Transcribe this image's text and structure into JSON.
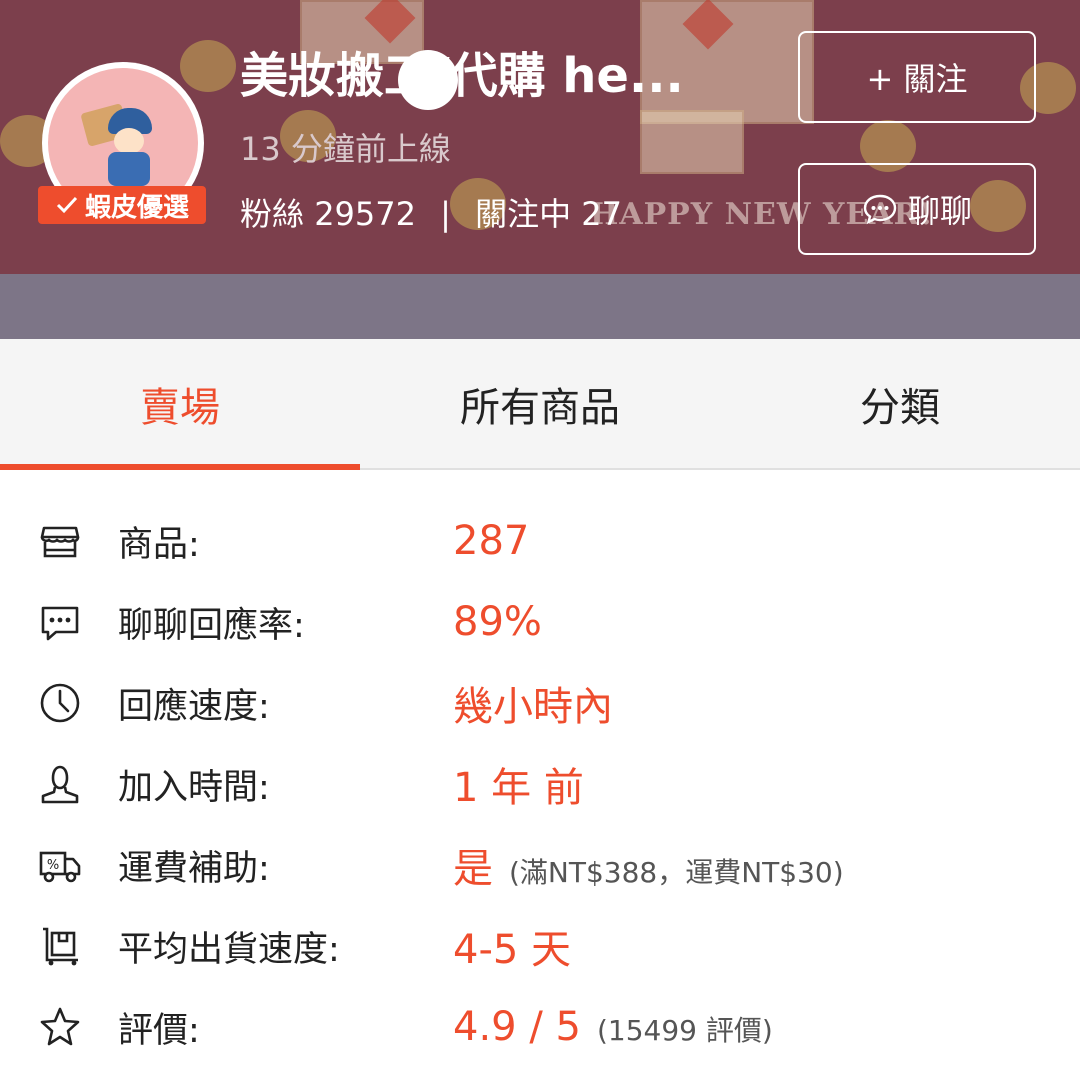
{
  "colors": {
    "accent": "#ee4d2d",
    "banner": "#7c3f4c",
    "band": "#7d7587"
  },
  "header": {
    "shop_name": "美妝搬工/代購 he...",
    "online_status": "13 分鐘前上線",
    "followers_label": "粉絲",
    "followers_count": "29572",
    "separator": "|",
    "following_label": "關注中",
    "following_count": "27",
    "badge": "蝦皮優選",
    "banner_text": "HAPPY NEW YEAR!",
    "follow_button": "+ 關注",
    "chat_button": "聊聊"
  },
  "tabs": [
    {
      "label": "賣場",
      "active": true
    },
    {
      "label": "所有商品",
      "active": false
    },
    {
      "label": "分類",
      "active": false
    }
  ],
  "info": [
    {
      "icon": "shop-icon",
      "label": "商品:",
      "value": "287",
      "note": ""
    },
    {
      "icon": "chat-bubble-icon",
      "label": "聊聊回應率:",
      "value": "89%",
      "note": ""
    },
    {
      "icon": "clock-icon",
      "label": "回應速度:",
      "value": "幾小時內",
      "note": ""
    },
    {
      "icon": "user-icon",
      "label": "加入時間:",
      "value": "1 年 前",
      "note": ""
    },
    {
      "icon": "shipping-truck-icon",
      "label": "運費補助:",
      "value": "是",
      "note": "(滿NT$388，運費NT$30)"
    },
    {
      "icon": "parcel-icon",
      "label": "平均出貨速度:",
      "value": "4-5 天",
      "note": ""
    },
    {
      "icon": "star-icon",
      "label": "評價:",
      "value": "4.9 / 5",
      "note": "(15499 評價)"
    }
  ]
}
